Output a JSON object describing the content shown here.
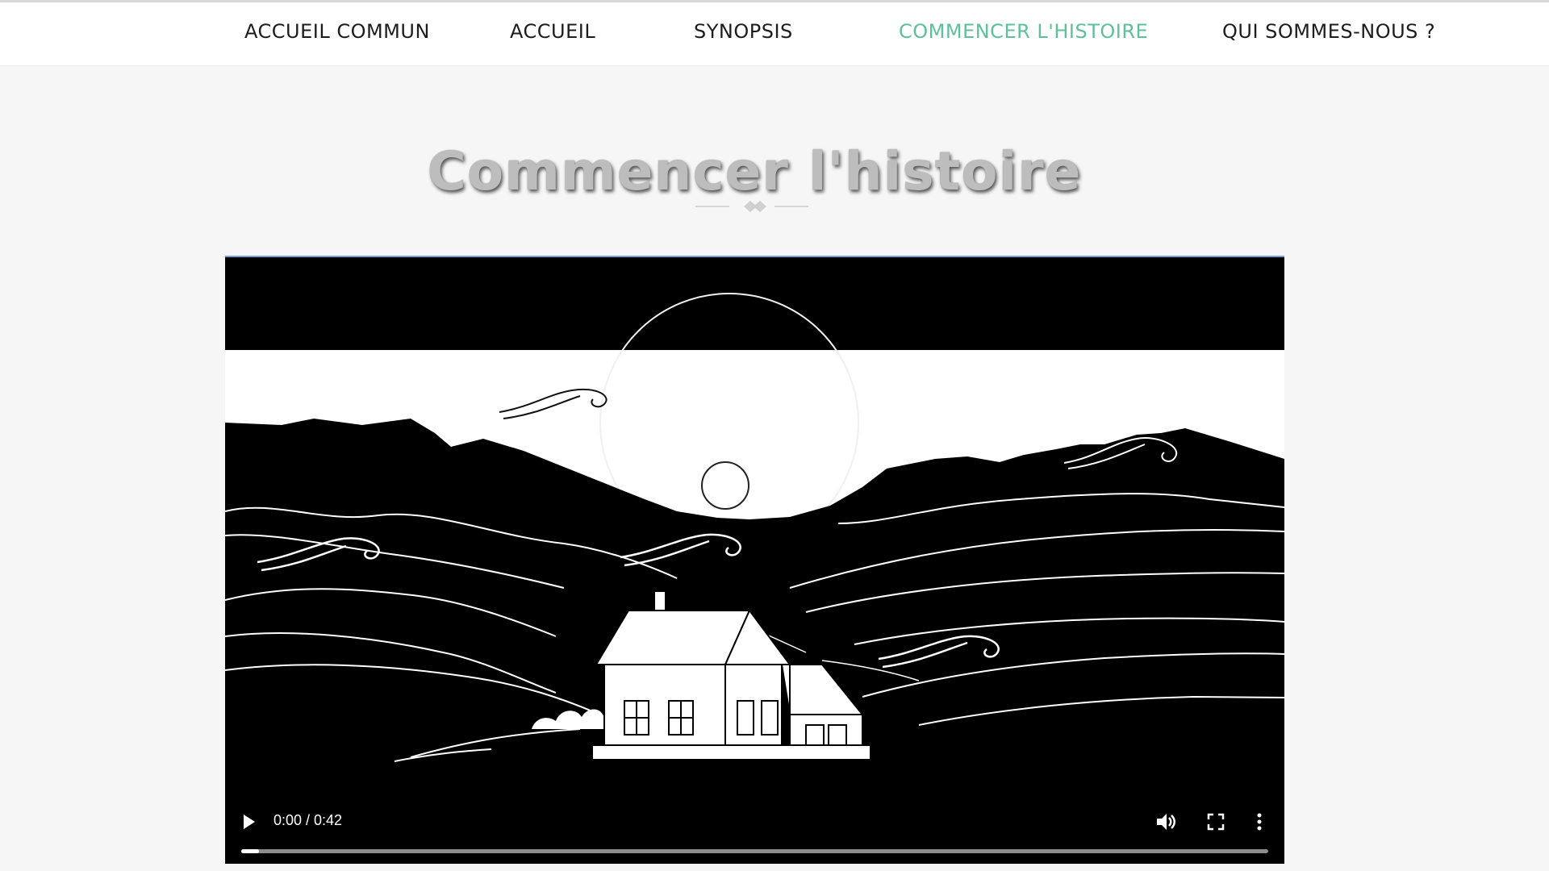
{
  "nav": {
    "items": [
      {
        "label": "Accueil commun"
      },
      {
        "label": "Accueil"
      },
      {
        "label": "Synopsis"
      },
      {
        "label": "Commencer l'histoire"
      },
      {
        "label": "Qui sommes-nous ?"
      }
    ],
    "active_index": 3,
    "active_color": "#5fbf9b"
  },
  "page": {
    "title": "Commencer l'histoire"
  },
  "video": {
    "time_current": "0:00",
    "time_total": "0:42",
    "time_display": "0:00 / 0:42",
    "progress_fraction": 0.0,
    "controls": {
      "play_icon": "play-icon",
      "volume_icon": "volume-icon",
      "fullscreen_icon": "fullscreen-icon",
      "more_icon": "more-vertical-icon"
    }
  },
  "colors": {
    "background": "#f6f6f6",
    "title": "#bdbdbd",
    "accent": "#5fbf9b",
    "video_bg": "#000000"
  }
}
